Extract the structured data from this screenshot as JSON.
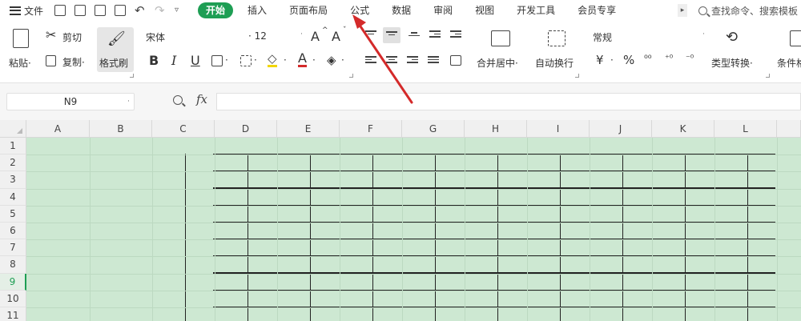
{
  "menubar": {
    "file_label": "文件",
    "tabs": [
      "开始",
      "插入",
      "页面布局",
      "公式",
      "数据",
      "审阅",
      "视图",
      "开发工具",
      "会员专享"
    ],
    "active_tab": "开始",
    "more_glyph": "▸",
    "search_placeholder": "查找命令、搜索模板"
  },
  "ribbon": {
    "paste_label": "粘贴",
    "cut_label": "剪切",
    "copy_label": "复制",
    "format_painter_label": "格式刷",
    "font_name": "宋体",
    "font_size": "12",
    "bold": "B",
    "italic": "I",
    "underline": "U",
    "font_grow": "A",
    "font_shrink": "A",
    "font_color_glyph": "A",
    "merge_label": "合并居中",
    "wrap_label": "自动换行",
    "number_format": "常规",
    "currency_glyph": "¥",
    "percent_glyph": "%",
    "type_convert_label": "类型转换",
    "cond_format_label": "条件格",
    "dropdown_caret": "▾",
    "dot_caret": "·"
  },
  "formula_bar": {
    "name_box": "N9",
    "fx_label": "fx",
    "formula": ""
  },
  "grid": {
    "columns": [
      "A",
      "B",
      "C",
      "D",
      "E",
      "F",
      "G",
      "H",
      "I",
      "J",
      "K",
      "L"
    ],
    "rows": [
      "1",
      "2",
      "3",
      "4",
      "5",
      "6",
      "7",
      "8",
      "9",
      "10",
      "11"
    ],
    "active_row": "9",
    "sheet_color": "#cde8d2"
  },
  "colors": {
    "accent": "#1e9e54",
    "arrow": "#d42a2a"
  }
}
